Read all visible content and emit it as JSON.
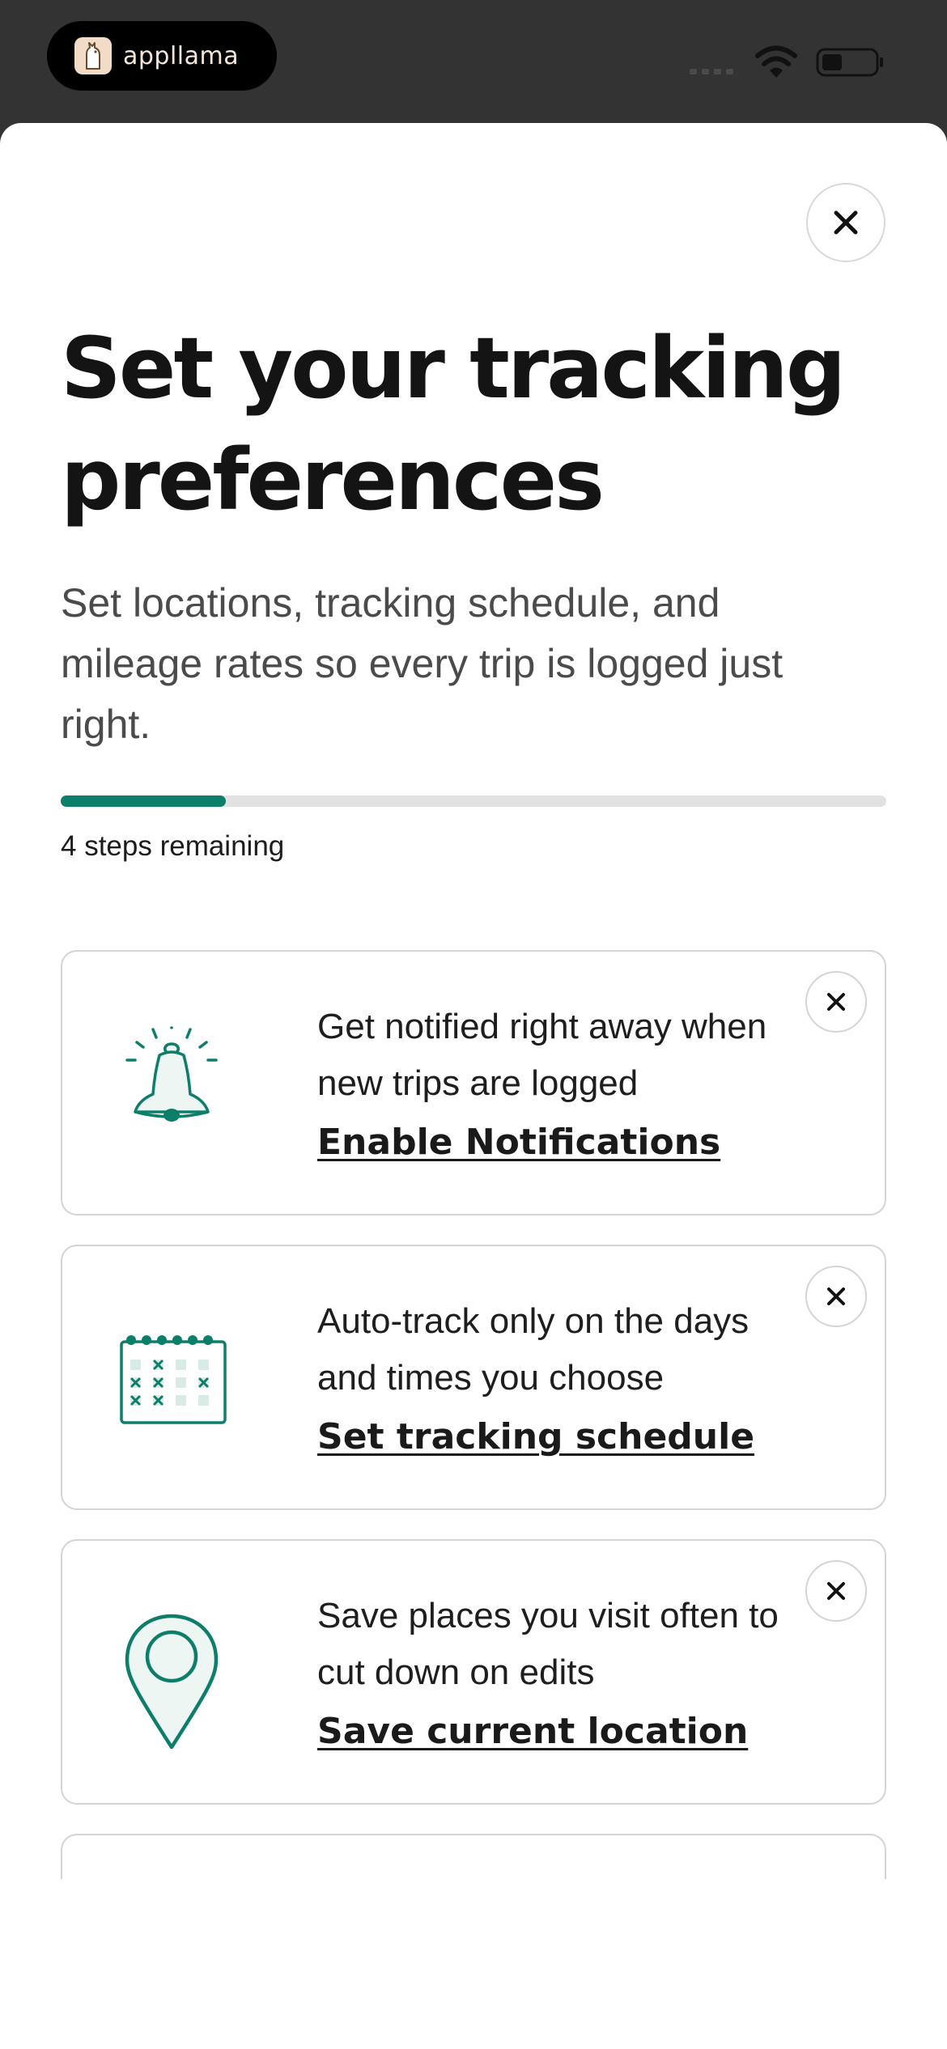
{
  "status_bar": {
    "app_name": "appllama"
  },
  "header": {
    "close_label": "Close"
  },
  "page": {
    "title": "Set your tracking preferences",
    "subtitle": "Set locations, tracking schedule, and mileage rates so every trip is logged just right."
  },
  "progress": {
    "completed_fraction": 0.2,
    "label": "4 steps remaining"
  },
  "cards": [
    {
      "icon": "bell-icon",
      "description": "Get notified right away when new trips are logged",
      "link": "Enable Notifications"
    },
    {
      "icon": "calendar-icon",
      "description": "Auto-track only on the days and times you choose",
      "link": "Set tracking schedule"
    },
    {
      "icon": "location-pin-icon",
      "description": "Save places you visit often to cut down on edits",
      "link": "Save current location"
    }
  ],
  "colors": {
    "accent": "#0c7e6a",
    "status_bar": "#333333",
    "icon_fill": "#eef6f4"
  }
}
